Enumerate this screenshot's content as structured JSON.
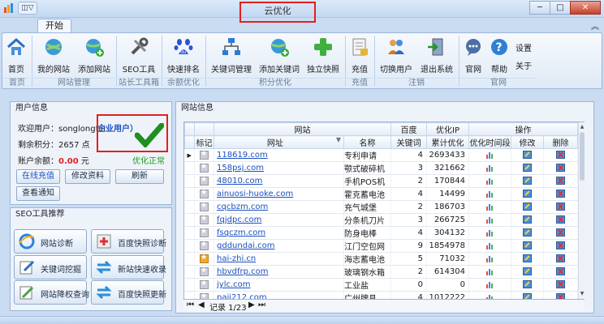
{
  "window": {
    "title": "云优化",
    "quick_access": "◫▽"
  },
  "ribbon": {
    "tab": "开始",
    "buttons": [
      {
        "label": "首页",
        "icon": "home-icon"
      },
      {
        "label": "我的网站",
        "icon": "globe-icon"
      },
      {
        "label": "添加网站",
        "icon": "globe-add-icon"
      },
      {
        "label": "SEO工具",
        "icon": "tools-icon"
      },
      {
        "label": "快速排名",
        "icon": "baidu-icon"
      },
      {
        "label": "关键词管理",
        "icon": "network-icon"
      },
      {
        "label": "添加关键词",
        "icon": "globe-add-icon"
      },
      {
        "label": "独立快照",
        "icon": "plus-icon"
      },
      {
        "label": "充值",
        "icon": "document-icon"
      },
      {
        "label": "切换用户",
        "icon": "users-icon"
      },
      {
        "label": "退出系统",
        "icon": "exit-icon"
      },
      {
        "label": "官网",
        "icon": "chat-icon"
      },
      {
        "label": "帮助",
        "icon": "help-icon"
      }
    ],
    "settings": "设置",
    "about": "关于",
    "groups": [
      "首页",
      "网站管理",
      "站长工具箱",
      "余额优化",
      "积分优化",
      "充值",
      "注销",
      "官网"
    ]
  },
  "user_info": {
    "title": "用户信息",
    "welcome_label": "欢迎用户：",
    "username": "songlongfei",
    "user_type": "企业用户）",
    "points_label": "剩余积分：",
    "points": "2657 点",
    "balance_label": "账户余额：",
    "balance": "0.00",
    "balance_unit": "元",
    "status": "优化正常",
    "buttons": {
      "recharge": "在线充值",
      "edit": "修改资料",
      "refresh": "刷新",
      "notice": "查看通知"
    }
  },
  "seo_tools": {
    "title": "SEO工具推荐",
    "items": [
      {
        "label": "网站诊断",
        "icon": "ie-icon"
      },
      {
        "label": "百度快照诊断",
        "icon": "medical-icon"
      },
      {
        "label": "关键词挖掘",
        "icon": "edit-icon"
      },
      {
        "label": "新站快速收录",
        "icon": "arrows-icon"
      },
      {
        "label": "网站降权查询",
        "icon": "pen-icon"
      },
      {
        "label": "百度快照更新",
        "icon": "arrows-icon"
      }
    ]
  },
  "site_info": {
    "title": "网站信息",
    "group_headers": {
      "site": "网站",
      "baidu": "百度",
      "opt_ip": "优化IP",
      "ops": "操作"
    },
    "columns": [
      "标记",
      "网址",
      "名称",
      "关键词",
      "累计优化",
      "优化时间段",
      "修改",
      "删除"
    ],
    "rows": [
      {
        "url": "118619.com",
        "name": "专利申请",
        "keywords": "4",
        "total": "2693433",
        "gold": false,
        "current": true
      },
      {
        "url": "158psj.com",
        "name": "颚式破碎机",
        "keywords": "3",
        "total": "321662",
        "gold": false,
        "current": false
      },
      {
        "url": "48010.com",
        "name": "手机POS机",
        "keywords": "2",
        "total": "170844",
        "gold": false,
        "current": false
      },
      {
        "url": "ainuosi-huoke.com",
        "name": "霍克蓄电池",
        "keywords": "4",
        "total": "14499",
        "gold": false,
        "current": false
      },
      {
        "url": "cqcbzm.com",
        "name": "充气城堡",
        "keywords": "2",
        "total": "186703",
        "gold": false,
        "current": false
      },
      {
        "url": "fqjdpc.com",
        "name": "分条机刀片",
        "keywords": "3",
        "total": "266725",
        "gold": false,
        "current": false
      },
      {
        "url": "fsqczm.com",
        "name": "防身电棒",
        "keywords": "4",
        "total": "304132",
        "gold": false,
        "current": false
      },
      {
        "url": "gddundai.com",
        "name": "江门空包网",
        "keywords": "9",
        "total": "1854978",
        "gold": false,
        "current": false
      },
      {
        "url": "hai-zhi.cn",
        "name": "海志蓄电池",
        "keywords": "5",
        "total": "71032",
        "gold": true,
        "current": false
      },
      {
        "url": "hbvdfrp.com",
        "name": "玻璃钢水箱",
        "keywords": "2",
        "total": "614304",
        "gold": false,
        "current": false
      },
      {
        "url": "jylc.com",
        "name": "工业盐",
        "keywords": "0",
        "total": "0",
        "gold": false,
        "current": false
      },
      {
        "url": "paii212.com",
        "name": "广州牌具",
        "keywords": "4",
        "total": "1012222",
        "gold": false,
        "current": false
      }
    ],
    "navigator": "记录 1/23"
  },
  "colors": {
    "accent": "#1a4fbf",
    "status_ok": "#1aa01a",
    "balance": "#e02020",
    "highlight_box": "#e02020"
  }
}
